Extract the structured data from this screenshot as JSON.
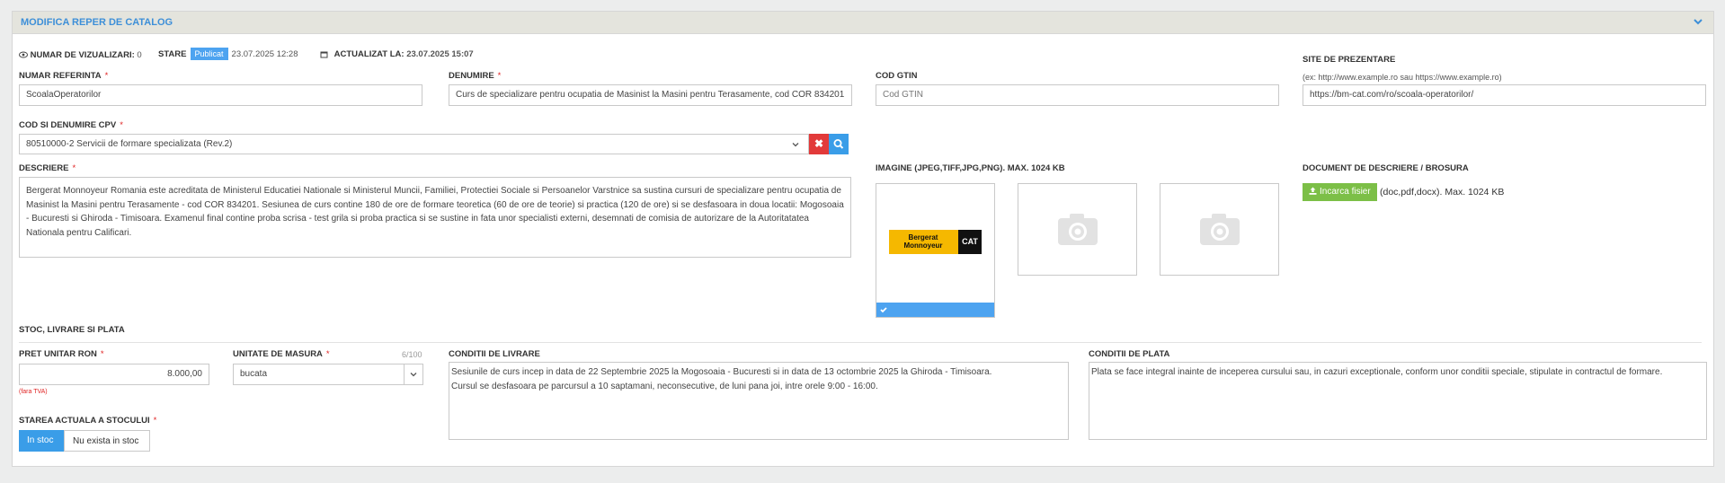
{
  "header": {
    "title": "MODIFICA REPER DE CATALOG"
  },
  "meta": {
    "views_label": "NUMAR DE VIZUALIZARI:",
    "views_value": "0",
    "state_label": "STARE",
    "state_badge": "Publicat",
    "state_date": "23.07.2025 12:28",
    "updated_label": "ACTUALIZAT LA:",
    "updated_value": "23.07.2025 15:07"
  },
  "fields": {
    "ref_label": "NUMAR REFERINTA",
    "ref_value": "ScoalaOperatorilor",
    "name_label": "DENUMIRE",
    "name_value": "Curs de specializare pentru ocupatia de Masinist la Masini pentru Terasamente, cod COR 834201",
    "gtin_label": "COD GTIN",
    "gtin_placeholder": "Cod GTIN",
    "site_label": "SITE DE PREZENTARE",
    "site_hint": "(ex: http://www.example.ro sau https://www.example.ro)",
    "site_value": "https://bm-cat.com/ro/scoala-operatorilor/",
    "cpv_label": "COD SI DENUMIRE CPV",
    "cpv_value": "80510000-2 Servicii de formare specializata (Rev.2)",
    "desc_label": "DESCRIERE",
    "desc_value": "Bergerat Monnoyeur Romania este acreditata de Ministerul Educatiei Nationale si Ministerul Muncii, Familiei, Protectiei Sociale si Persoanelor Varstnice sa sustina cursuri de specializare pentru ocupatia de Masinist la Masini pentru Terasamente - cod COR 834201. Sesiunea de curs contine 180 de ore de formare teoretica (60 de ore de teorie)  si practica (120 de ore) si se desfasoara in doua locatii: Mogosoaia - Bucuresti si Ghiroda - Timisoara. Examenul final contine proba scrisa - test grila si proba practica si se sustine in fata unor specialisti externi, desemnati de comisia de autorizare de la Autoritatatea Nationala pentru Calificari.",
    "image_label": "IMAGINE (JPEG,TIFF,JPG,PNG). MAX. 1024 KB",
    "logo_line1": "Bergerat",
    "logo_line2": "Monnoyeur",
    "logo_cat": "CAT",
    "doc_label": "DOCUMENT DE DESCRIERE / BROSURA",
    "upload_label": "Incarca fisier",
    "doc_hint": "(doc,pdf,docx). Max. 1024 KB"
  },
  "stock": {
    "section_title": "STOC, LIVRARE SI PLATA",
    "price_label": "PRET UNITAR RON",
    "price_value": "8.000,00",
    "price_note": "(fara TVA)",
    "unit_label": "UNITATE DE MASURA",
    "unit_counter": "6/100",
    "unit_value": "bucata",
    "stock_state_label": "STAREA ACTUALA A STOCULUI",
    "in_stock": "In stoc",
    "no_stock": "Nu exista in stoc",
    "delivery_label": "CONDITII DE LIVRARE",
    "delivery_line1": "Sesiunile de curs incep in data de 22 Septembrie 2025 la Mogosoaia - Bucuresti si in data de 13 octombrie 2025 la  Ghiroda - Timisoara.",
    "delivery_line2": "Cursul se desfasoara pe parcursul a 10 saptamani, neconsecutive, de luni pana joi, intre orele 9:00 - 16:00.",
    "payment_label": "CONDITII DE PLATA",
    "payment_value": "Plata se face integral inainte de inceperea cursului sau, in cazuri exceptionale, conform unor conditii speciale, stipulate in contractul de formare."
  },
  "colors": {
    "accent": "#3d8fd8",
    "header_bg": "#e4e4dd",
    "required": "#e02424",
    "upload": "#7cbf47",
    "clear_btn": "#e23a3a"
  }
}
